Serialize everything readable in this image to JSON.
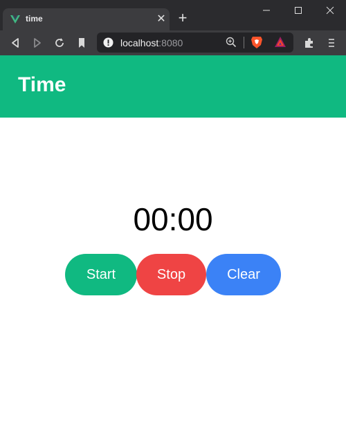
{
  "browser": {
    "tab": {
      "title": "time",
      "favicon": "vue-logo-icon"
    },
    "address": {
      "host": "localhost",
      "port": ":8080"
    }
  },
  "app": {
    "title": "Time",
    "timer": "00:00",
    "buttons": {
      "start": {
        "label": "Start",
        "color": "#10b981"
      },
      "stop": {
        "label": "Stop",
        "color": "#ef4444"
      },
      "clear": {
        "label": "Clear",
        "color": "#3b82f6"
      }
    },
    "header_color": "#10b981"
  }
}
